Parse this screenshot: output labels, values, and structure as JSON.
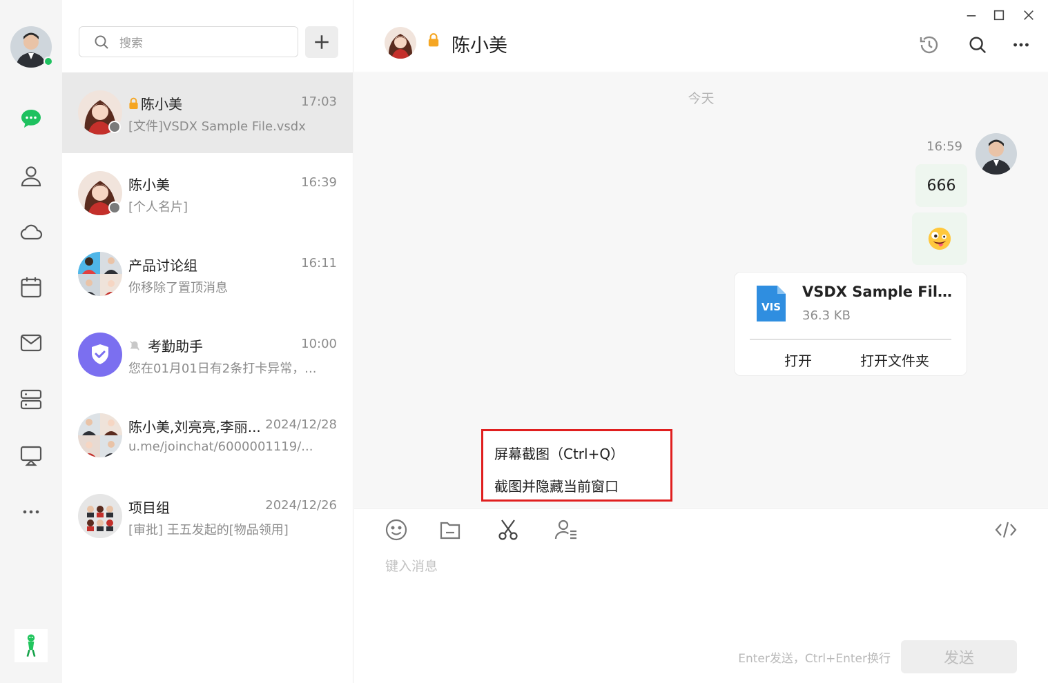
{
  "search": {
    "placeholder": "搜索"
  },
  "conversations": [
    {
      "name": "陈小美",
      "time": "17:03",
      "preview": "[文件]VSDX Sample File.vsdx"
    },
    {
      "name": "陈小美",
      "time": "16:39",
      "preview": "[个人名片]"
    },
    {
      "name": "产品讨论组",
      "time": "16:11",
      "preview": "你移除了置顶消息"
    },
    {
      "name": "考勤助手",
      "time": "10:00",
      "preview": "您在01月01日有2条打卡异常，..."
    },
    {
      "name": "陈小美,刘亮亮,李丽...",
      "time": "2024/12/28",
      "preview": "u.me/joinchat/6000001119/..."
    },
    {
      "name": "项目组",
      "time": "2024/12/26",
      "preview": "[审批] 王五发起的[物品领用]"
    }
  ],
  "chat": {
    "title": "陈小美",
    "date_separator": "今天",
    "message_time": "16:59",
    "text_message": "666",
    "file": {
      "name": "VSDX Sample File....",
      "size": "36.3 KB",
      "type_label": "VIS",
      "open": "打开",
      "open_folder": "打开文件夹"
    }
  },
  "composer": {
    "placeholder": "键入消息",
    "hint": "Enter发送，Ctrl+Enter换行",
    "send": "发送"
  },
  "context_menu": {
    "items": [
      "屏幕截图（Ctrl+Q）",
      "截图并隐藏当前窗口"
    ]
  },
  "colors": {
    "accent_green": "#1ec15f",
    "file_blue": "#2f8ee0",
    "highlight_red": "#e01f1f"
  }
}
